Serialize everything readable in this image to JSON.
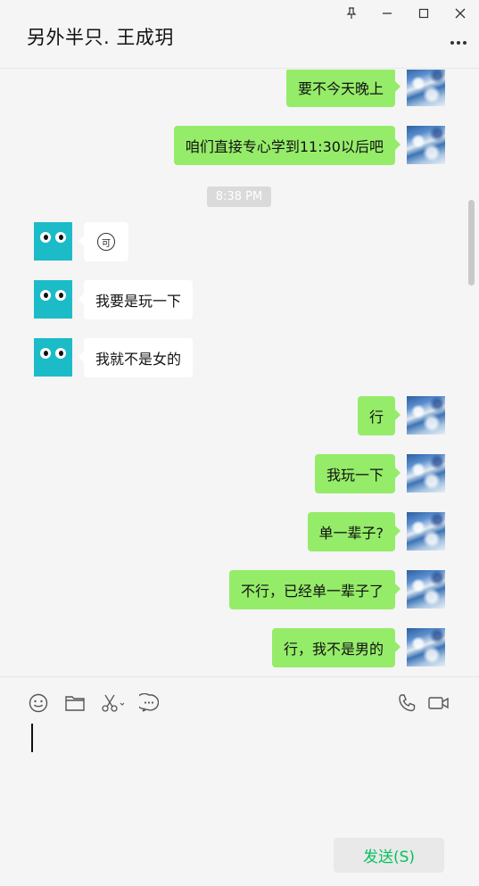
{
  "window": {
    "title": "另外半只. 王成玥",
    "controls": [
      "pin-icon",
      "minimize-icon",
      "maximize-icon",
      "close-icon"
    ]
  },
  "messages": [
    {
      "sender": "me",
      "text": "要不今天晚上"
    },
    {
      "sender": "me",
      "text": "咱们直接专心学到11:30以后吧"
    },
    {
      "type": "time",
      "text": "8:38 PM"
    },
    {
      "sender": "other",
      "type": "emoji",
      "text": "可"
    },
    {
      "sender": "other",
      "text": "我要是玩一下"
    },
    {
      "sender": "other",
      "text": "我就不是女的"
    },
    {
      "sender": "me",
      "text": "行"
    },
    {
      "sender": "me",
      "text": "我玩一下"
    },
    {
      "sender": "me",
      "text": "单一辈子?"
    },
    {
      "sender": "me",
      "text": "不行，已经单一辈子了"
    },
    {
      "sender": "me",
      "text": "行，我不是男的"
    }
  ],
  "toolbar": {
    "icons": [
      "emoji-icon",
      "folder-icon",
      "scissors-icon",
      "chat-history-icon",
      "phone-icon",
      "video-call-icon"
    ],
    "send_label": "发送(S)"
  },
  "colors": {
    "my_bubble": "#95ec69",
    "their_bubble": "#ffffff",
    "background": "#f5f5f5",
    "send_text": "#07c160",
    "their_avatar": "#1bbcc8"
  }
}
